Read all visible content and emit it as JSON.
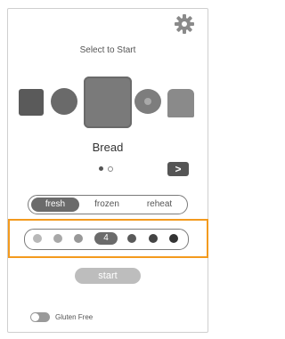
{
  "screen": {
    "heading": "Select to Start",
    "selected_item": "Bread",
    "accent_highlight_color": "#f39a1e"
  },
  "icons": {
    "settings": "gear-icon",
    "next": "chevron-right-icon"
  },
  "carousel": {
    "items": [
      "waffle",
      "english-muffin",
      "bread",
      "bagel",
      "toast-slice"
    ],
    "page_indicator": {
      "current": 1,
      "total": 2
    },
    "next_label": ">"
  },
  "modes": {
    "options": [
      "fresh",
      "frozen",
      "reheat"
    ],
    "selected": "fresh"
  },
  "darkness": {
    "selected_label": "4",
    "levels_total": 7
  },
  "actions": {
    "start_label": "start"
  },
  "settings": {
    "gluten_free_label": "Gluten Free",
    "gluten_free_on": false
  }
}
